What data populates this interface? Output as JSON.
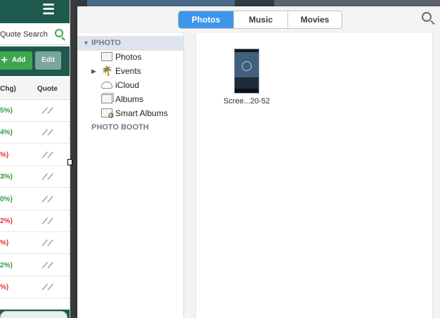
{
  "background_app": {
    "search_label": "Quote Search",
    "add_label": "Add",
    "edit_label": "Edit",
    "col_change": "Chg)",
    "col_quote": "Quote",
    "rows": [
      {
        "pct": "5%)",
        "dir": "up"
      },
      {
        "pct": "4%)",
        "dir": "up"
      },
      {
        "pct": "%)",
        "dir": "down"
      },
      {
        "pct": "3%)",
        "dir": "up"
      },
      {
        "pct": "0%)",
        "dir": "up"
      },
      {
        "pct": "2%)",
        "dir": "down"
      },
      {
        "pct": "%)",
        "dir": "down"
      },
      {
        "pct": "2%)",
        "dir": "up"
      },
      {
        "pct": "%)",
        "dir": "down"
      }
    ]
  },
  "media_browser": {
    "tabs": [
      {
        "label": "Photos",
        "active": true
      },
      {
        "label": "Music",
        "active": false
      },
      {
        "label": "Movies",
        "active": false
      }
    ],
    "search_icon": "magnifier-icon",
    "sidebar": {
      "iphoto_header": "IPHOTO",
      "items": [
        {
          "label": "Photos",
          "icon": "photos-icon"
        },
        {
          "label": "Events",
          "icon": "events-icon"
        },
        {
          "label": "iCloud",
          "icon": "icloud-icon"
        },
        {
          "label": "Albums",
          "icon": "albums-icon"
        },
        {
          "label": "Smart Albums",
          "icon": "smart-albums-icon"
        }
      ],
      "photobooth_header": "PHOTO BOOTH"
    },
    "content": {
      "items": [
        {
          "caption": "Scree...20-52"
        }
      ]
    }
  },
  "colors": {
    "accent_blue": "#3d96e9",
    "app_green": "#1d5a4d",
    "up_green": "#2f9a3f",
    "down_red": "#e0383a"
  }
}
